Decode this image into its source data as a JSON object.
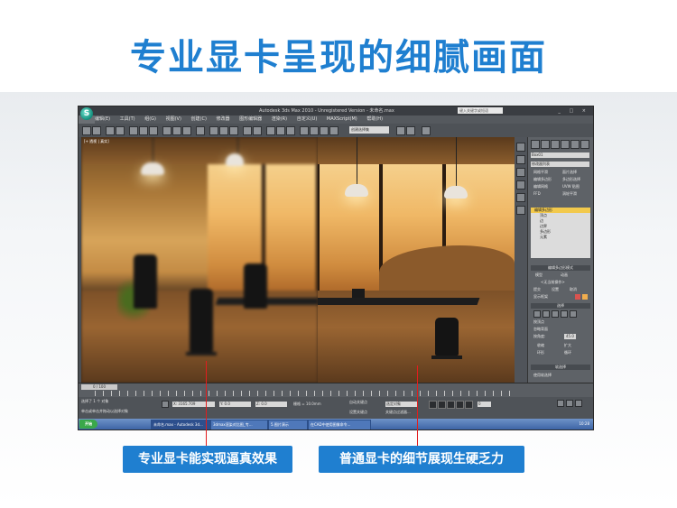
{
  "headline": "专业显卡呈现的细腻画面",
  "app": {
    "title": "Autodesk 3ds Max 2010 - Unregistered Version - 未命名.max",
    "search_placeholder": "键入关键字或短语",
    "menu": [
      "编辑(E)",
      "工具(T)",
      "组(G)",
      "视图(V)",
      "创建(C)",
      "修改器",
      "图形编辑器",
      "渲染(R)",
      "自定义(U)",
      "MAXScript(M)",
      "帮助(H)"
    ],
    "toolbar_selection_set": "创建选择集",
    "viewport_label": "[+ 透视 | 真实]",
    "panel": {
      "object_name": "Box01",
      "modifier_list": "修改器列表",
      "buttons": [
        "网格平滑",
        "面片选择",
        "编辑多边形",
        "多边形选择",
        "编辑网格",
        "UVW 贴图",
        "FFD",
        "涡轮平滑"
      ],
      "stack": [
        "编辑多边形",
        "顶点",
        "边",
        "边界",
        "多边形",
        "元素"
      ],
      "stack_selected_index": 0,
      "sections": [
        "编辑多边形模式",
        "选择",
        "软选择"
      ],
      "mode_options": [
        "模型",
        "动画"
      ],
      "no_op": "<无当前操作>",
      "mode_buttons": [
        "提交",
        "设置",
        "取消"
      ],
      "show_cage": "显示框架",
      "selection_rows": [
        "按顶点",
        "忽略背面",
        "按角度:",
        "收缩",
        "扩大",
        "环形",
        "循环"
      ],
      "soft_selection": "使用软选择",
      "angle_value": "45.0"
    },
    "timeline": {
      "frame_display": "0 / 100"
    },
    "status": {
      "selection": "选择了 1 个 对象",
      "prompt": "单击或单击并拖动以选择对象",
      "x": "X: 3165.709",
      "y": "Y: 0.0",
      "z": "Z: 0.0",
      "grid": "栅格 = 10.0mm",
      "auto_key": "自动关键点",
      "set_key": "设置关键点",
      "filter": "选定对象",
      "key_filters": "关键点过滤器...",
      "frame": "0"
    },
    "taskbar": {
      "start": "开始",
      "tasks": [
        "未命名.max - Autodesk 3d...",
        "3dmax渲染对比图_专...",
        "5.图片演示",
        "在CAD中使用图像命令..."
      ],
      "active_task_index": 0,
      "clock": "10:28"
    }
  },
  "callouts": {
    "left": "专业显卡能实现逼真效果",
    "right": "普通显卡的细节展现生硬乏力"
  },
  "colors": {
    "headline": "#1f7fd0",
    "caption_bg": "#1f7fd0",
    "pointer": "#e21d1d"
  }
}
